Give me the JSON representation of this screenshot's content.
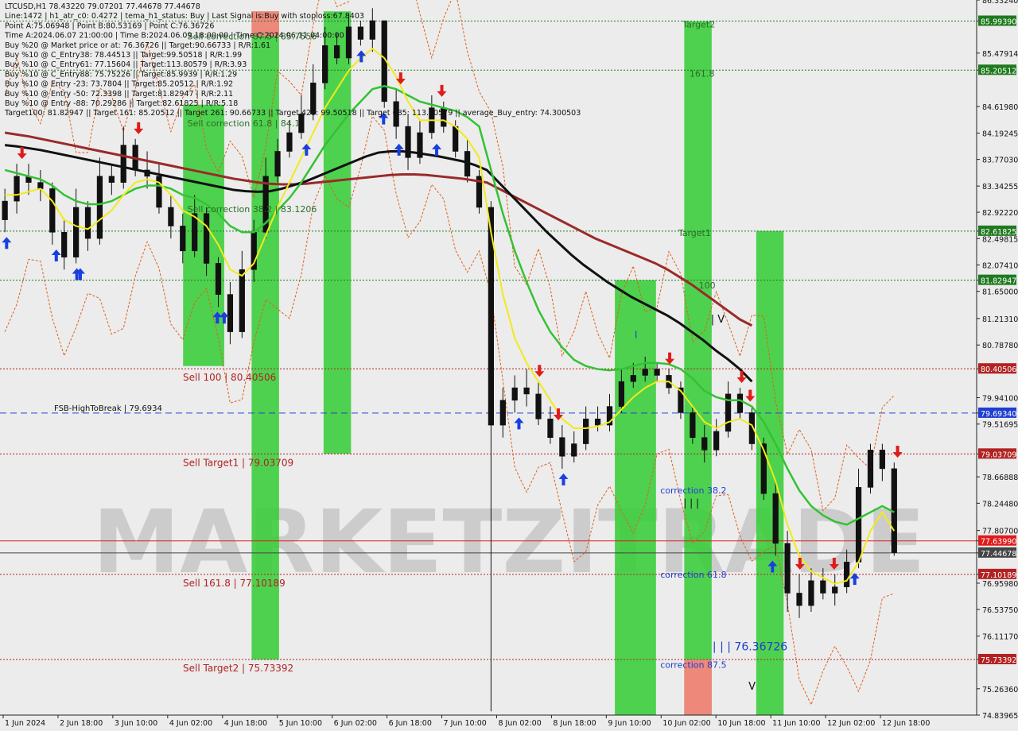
{
  "info_lines": [
    "LTCUSD,H1  78.43220 79.07201 77.44678 77.44678",
    "Line:1472 | h1_atr_c0: 0.4272 | tema_h1_status: Buy | Last Signal is:Buy with stoploss:67.8403",
    "Point A:75.06948 | Point B:80.53169 | Point C:76.36726",
    "Time A:2024.06.07 21:00:00 | Time B:2024.06.09 18:00:00 | Time C:2024.06.11 04:00:00",
    "Buy %20 @ Market price or at: 76.36726 || Target:90.66733 | R/R:1.61",
    "Buy %10 @ C_Entry38: 78.44513 || Target:99.50518 | R/R:1.99",
    "Buy %10 @ C_Entry61: 77.15604 || Target:113.80579 | R/R:3.93",
    "Buy %10 @ C_Entry88: 75.75226 || Target:85.9939 | R/R:1.29",
    "Buy %10 @ Entry -23: 73.7804 || Target:85.20512 | R/R:1.92",
    "Buy %10 @ Entry -50: 72.3398 || Target:81.82947 | R/R:2.11",
    "Buy %10 @ Entry -88: 70.29286 || Target:82.61825 | R/R:5.18",
    "Target100: 81.82947 || Target 161: 85.20512 || Target 261: 90.66733 || Target 423: 99.50518 || Target 685: 113.80579 || average_Buy_entry: 74.300503"
  ],
  "watermark": "MARKETZITRADE",
  "chart_data": {
    "type": "candlestick",
    "symbol": "LTCUSD",
    "timeframe": "H1",
    "ylim": [
      74.83965,
      86.3324
    ],
    "xlim": [
      0,
      1472
    ],
    "y_ticks": [
      "86.33240",
      "85.99390",
      "85.47914",
      "85.20512",
      "84.61980",
      "84.19245",
      "83.77030",
      "83.34255",
      "82.92220",
      "82.61825",
      "82.49815",
      "82.07410",
      "81.82947",
      "81.65000",
      "81.21310",
      "80.78780",
      "80.40506",
      "79.94100",
      "79.69340",
      "79.51695",
      "79.03709",
      "78.66888",
      "78.24480",
      "77.80700",
      "77.63990",
      "77.44678",
      "77.10189",
      "76.95980",
      "76.53750",
      "76.11170",
      "75.73392",
      "75.26360",
      "74.83965"
    ],
    "x_ticks": [
      {
        "label": "1 Jun 2024",
        "t": 0
      },
      {
        "label": "2 Jun 18:00",
        "t": 64
      },
      {
        "label": "3 Jun 10:00",
        "t": 128
      },
      {
        "label": "4 Jun 02:00",
        "t": 192
      },
      {
        "label": "4 Jun 18:00",
        "t": 256
      },
      {
        "label": "5 Jun 10:00",
        "t": 320
      },
      {
        "label": "6 Jun 02:00",
        "t": 384
      },
      {
        "label": "6 Jun 18:00",
        "t": 448
      },
      {
        "label": "7 Jun 10:00",
        "t": 512
      },
      {
        "label": "8 Jun 02:00",
        "t": 576
      },
      {
        "label": "8 Jun 18:00",
        "t": 640
      },
      {
        "label": "9 Jun 10:00",
        "t": 704
      },
      {
        "label": "10 Jun 02:00",
        "t": 768
      },
      {
        "label": "10 Jun 18:00",
        "t": 832
      },
      {
        "label": "11 Jun 10:00",
        "t": 896
      },
      {
        "label": "12 Jun 02:00",
        "t": 960
      },
      {
        "label": "12 Jun 18:00",
        "t": 1024
      }
    ],
    "h_levels": [
      {
        "label": "",
        "price": 85.9939,
        "color": "#1f7a1f",
        "axis_label": "85.99390"
      },
      {
        "label": "",
        "price": 85.20512,
        "color": "#1f7a1f",
        "axis_label": "85.20512"
      },
      {
        "label": "",
        "price": 82.61825,
        "color": "#1f7a1f",
        "axis_label": "82.61825"
      },
      {
        "label": "",
        "price": 81.82947,
        "color": "#1f7a1f",
        "axis_label": "81.82947"
      },
      {
        "label": "Sell 100 | 80.40506",
        "price": 80.40506,
        "color": "#b22222",
        "axis_label": "80.40506"
      },
      {
        "label": "FSB-HighToBreak | 79.6934",
        "price": 79.6934,
        "color": "#1f3fd0",
        "axis_label": "79.69340",
        "dash": "long"
      },
      {
        "label": "Sell Target1 | 79.03709",
        "price": 79.03709,
        "color": "#b22222",
        "axis_label": "79.03709"
      },
      {
        "label": "Sell 161.8 | 77.10189",
        "price": 77.10189,
        "color": "#b22222",
        "axis_label": "77.10189"
      },
      {
        "label": "Sell Target2 | 75.73392",
        "price": 75.73392,
        "color": "#b22222",
        "axis_label": "75.73392"
      }
    ],
    "solid_levels": [
      {
        "price": 77.6399,
        "color": "#e01b1b",
        "axis_label": "77.63990"
      },
      {
        "price": 77.44678,
        "color": "#444444",
        "axis_label": "77.44678"
      }
    ],
    "zones": [
      {
        "t0": 210,
        "t1": 258,
        "p0": 80.45,
        "p1": 84.65,
        "color": "#33cc33"
      },
      {
        "t0": 290,
        "t1": 322,
        "p0": 75.73,
        "p1": 86.15,
        "color": "#33cc33"
      },
      {
        "t0": 290,
        "t1": 322,
        "p0": 85.75,
        "p1": 86.15,
        "color": "#ff7f7f"
      },
      {
        "t0": 374,
        "t1": 406,
        "p0": 79.04,
        "p1": 86.15,
        "color": "#33cc33"
      },
      {
        "t0": 714,
        "t1": 762,
        "p0": 74.84,
        "p1": 81.83,
        "color": "#33cc33"
      },
      {
        "t0": 795,
        "t1": 827,
        "p0": 74.84,
        "p1": 85.99,
        "color": "#33cc33"
      },
      {
        "t0": 795,
        "t1": 827,
        "p0": 74.84,
        "p1": 75.73,
        "color": "#ff7f7f"
      },
      {
        "t0": 879,
        "t1": 911,
        "p0": 74.84,
        "p1": 82.62,
        "color": "#33cc33"
      }
    ],
    "texts": [
      {
        "text": "Target2",
        "t": 793,
        "p": 85.89,
        "color": "#2a6e2a",
        "size": 11
      },
      {
        "text": "161.8",
        "t": 801,
        "p": 85.1,
        "color": "#2a6e2a",
        "size": 11
      },
      {
        "text": "Target1",
        "t": 788,
        "p": 82.54,
        "color": "#2a6e2a",
        "size": 11
      },
      {
        "text": "100",
        "t": 812,
        "p": 81.7,
        "color": "#2a6e2a",
        "size": 11
      },
      {
        "text": "Sell correction 61.8 | 84.1",
        "t": 215,
        "p": 84.3,
        "color": "#2a6e2a",
        "size": 11
      },
      {
        "text": "Sell correction 38.2 | 83.1206",
        "t": 215,
        "p": 82.92,
        "color": "#2a6e2a",
        "size": 11
      },
      {
        "text": "Sell correction 87.5 | 85.7556",
        "t": 215,
        "p": 85.7,
        "color": "#2a6e2a",
        "size": 11
      },
      {
        "text": "correction 38.2",
        "t": 767,
        "p": 78.4,
        "color": "#1f3fd0",
        "size": 11
      },
      {
        "text": "correction 61.8",
        "t": 767,
        "p": 77.05,
        "color": "#1f3fd0",
        "size": 11
      },
      {
        "text": "correction 87.5",
        "t": 767,
        "p": 75.6,
        "color": "#1f3fd0",
        "size": 11
      },
      {
        "text": "| | | 76.36726",
        "t": 828,
        "p": 75.88,
        "color": "#1f3fd0",
        "size": 14
      },
      {
        "text": "| V",
        "t": 826,
        "p": 81.15,
        "color": "#111111",
        "size": 13
      },
      {
        "text": "I",
        "t": 737,
        "p": 80.9,
        "color": "#1f3fd0",
        "size": 12
      },
      {
        "text": "| | |",
        "t": 794,
        "p": 78.2,
        "color": "#111111",
        "size": 12
      },
      {
        "text": "V",
        "t": 870,
        "p": 75.25,
        "color": "#111111",
        "size": 13
      }
    ],
    "up_arrows_t": [
      4,
      62,
      86,
      90,
      250,
      258,
      354,
      418,
      444,
      462,
      506,
      602,
      654,
      898,
      994
    ],
    "down_arrows_t": [
      22,
      158,
      464,
      512,
      626,
      648,
      778,
      862,
      872,
      930,
      970,
      1044
    ],
    "series_close": [
      83.1,
      83.5,
      83.4,
      83.3,
      82.6,
      82.2,
      83.0,
      82.5,
      83.5,
      83.4,
      84.0,
      83.6,
      83.5,
      83.0,
      82.7,
      82.3,
      82.9,
      82.1,
      81.6,
      81.0,
      82.0,
      82.6,
      83.5,
      83.9,
      84.2,
      84.5,
      85.0,
      85.6,
      85.4,
      85.9,
      85.7,
      86.0,
      84.7,
      84.3,
      83.8,
      84.2,
      84.6,
      84.3,
      83.9,
      83.5,
      83.0,
      79.5,
      79.9,
      80.1,
      80.0,
      79.6,
      79.3,
      79.0,
      79.2,
      79.6,
      79.5,
      79.8,
      80.2,
      80.3,
      80.4,
      80.3,
      80.1,
      79.7,
      79.3,
      79.1,
      79.4,
      80.0,
      79.7,
      79.2,
      78.4,
      77.6,
      76.8,
      76.6,
      77.0,
      76.8,
      76.9,
      77.3,
      78.5,
      79.1,
      78.8,
      77.45
    ],
    "series_open": [
      82.8,
      83.1,
      83.5,
      83.4,
      83.3,
      82.6,
      82.2,
      83.0,
      82.5,
      83.5,
      83.4,
      84.0,
      83.6,
      83.5,
      83.0,
      82.7,
      82.3,
      82.9,
      82.1,
      81.6,
      81.0,
      82.0,
      82.6,
      83.5,
      83.9,
      84.2,
      84.5,
      85.0,
      85.6,
      85.4,
      85.9,
      85.7,
      86.0,
      84.7,
      84.3,
      83.8,
      84.2,
      84.6,
      84.3,
      83.9,
      83.5,
      83.0,
      79.5,
      79.9,
      80.1,
      80.0,
      79.6,
      79.3,
      79.0,
      79.2,
      79.6,
      79.5,
      79.8,
      80.2,
      80.3,
      80.4,
      80.3,
      80.1,
      79.7,
      79.3,
      79.1,
      79.4,
      80.0,
      79.7,
      79.2,
      78.4,
      77.6,
      76.8,
      76.6,
      77.0,
      76.8,
      76.9,
      77.3,
      78.5,
      79.1,
      78.8
    ],
    "series_high": [
      83.3,
      83.7,
      83.7,
      83.6,
      83.4,
      82.8,
      83.3,
      83.1,
      83.8,
      83.7,
      84.3,
      84.1,
      83.9,
      83.7,
      83.2,
      82.9,
      83.2,
      83.0,
      82.2,
      81.8,
      82.3,
      82.8,
      83.8,
      84.1,
      84.4,
      84.8,
      85.3,
      85.9,
      85.8,
      86.1,
      86.0,
      86.2,
      86.0,
      84.9,
      84.5,
      84.4,
      84.8,
      84.7,
      84.4,
      84.1,
      83.6,
      83.1,
      80.1,
      80.3,
      80.4,
      80.2,
      79.8,
      79.5,
      79.4,
      79.8,
      79.8,
      80.0,
      80.4,
      80.5,
      80.6,
      80.5,
      80.4,
      80.2,
      79.8,
      79.5,
      79.6,
      80.2,
      80.1,
      79.8,
      79.3,
      78.6,
      77.8,
      77.1,
      77.2,
      77.2,
      77.1,
      77.5,
      78.8,
      79.2,
      79.2,
      78.9
    ],
    "series_low": [
      82.6,
      82.9,
      83.2,
      83.1,
      82.4,
      82.0,
      82.1,
      82.3,
      82.4,
      83.2,
      83.3,
      83.5,
      83.3,
      82.9,
      82.5,
      82.1,
      82.2,
      81.9,
      81.4,
      80.8,
      80.9,
      81.8,
      82.5,
      83.4,
      83.8,
      84.1,
      84.4,
      84.9,
      85.3,
      85.3,
      85.6,
      85.5,
      84.6,
      84.1,
      83.6,
      83.7,
      84.1,
      84.2,
      83.8,
      83.4,
      82.9,
      74.9,
      79.3,
      79.7,
      79.8,
      79.5,
      79.2,
      78.8,
      78.9,
      79.1,
      79.4,
      79.4,
      79.7,
      80.1,
      80.2,
      80.2,
      80.0,
      79.6,
      79.2,
      78.9,
      79.0,
      79.3,
      79.6,
      79.1,
      78.3,
      77.4,
      76.5,
      76.4,
      76.5,
      76.7,
      76.6,
      76.8,
      77.2,
      78.4,
      78.6,
      77.4
    ],
    "series_ma_yellow": [
      83.2,
      83.2,
      83.25,
      83.3,
      83.1,
      82.8,
      82.7,
      82.65,
      82.8,
      82.95,
      83.2,
      83.4,
      83.45,
      83.4,
      83.2,
      82.95,
      82.85,
      82.7,
      82.4,
      82.0,
      81.9,
      82.1,
      82.55,
      83.0,
      83.4,
      83.8,
      84.2,
      84.6,
      84.9,
      85.2,
      85.4,
      85.55,
      85.4,
      85.1,
      84.7,
      84.4,
      84.4,
      84.4,
      84.3,
      84.1,
      83.8,
      82.6,
      81.6,
      80.9,
      80.5,
      80.2,
      79.9,
      79.6,
      79.45,
      79.45,
      79.48,
      79.55,
      79.75,
      79.95,
      80.1,
      80.2,
      80.2,
      80.05,
      79.8,
      79.55,
      79.45,
      79.55,
      79.6,
      79.5,
      79.1,
      78.6,
      77.9,
      77.4,
      77.15,
      77.05,
      76.95,
      77.0,
      77.3,
      77.8,
      78.1,
      77.8
    ],
    "series_ma_green": [
      83.6,
      83.55,
      83.5,
      83.45,
      83.35,
      83.2,
      83.1,
      83.05,
      83.05,
      83.1,
      83.2,
      83.3,
      83.35,
      83.35,
      83.3,
      83.2,
      83.15,
      83.05,
      82.9,
      82.7,
      82.6,
      82.6,
      82.75,
      82.95,
      83.15,
      83.4,
      83.7,
      84.0,
      84.25,
      84.5,
      84.7,
      84.9,
      84.95,
      84.9,
      84.8,
      84.7,
      84.65,
      84.6,
      84.55,
      84.45,
      84.3,
      83.6,
      82.9,
      82.3,
      81.8,
      81.35,
      81.0,
      80.75,
      80.55,
      80.45,
      80.4,
      80.38,
      80.4,
      80.45,
      80.5,
      80.5,
      80.48,
      80.4,
      80.25,
      80.05,
      79.95,
      79.9,
      79.9,
      79.8,
      79.55,
      79.2,
      78.8,
      78.45,
      78.2,
      78.05,
      77.95,
      77.9,
      78.0,
      78.1,
      78.2,
      78.1
    ],
    "series_ma_black": [
      84.0,
      83.98,
      83.95,
      83.92,
      83.88,
      83.84,
      83.8,
      83.76,
      83.72,
      83.68,
      83.64,
      83.6,
      83.56,
      83.52,
      83.48,
      83.44,
      83.4,
      83.36,
      83.32,
      83.28,
      83.26,
      83.25,
      83.26,
      83.3,
      83.36,
      83.42,
      83.5,
      83.58,
      83.66,
      83.74,
      83.82,
      83.88,
      83.9,
      83.9,
      83.88,
      83.85,
      83.82,
      83.78,
      83.74,
      83.68,
      83.6,
      83.4,
      83.2,
      83.0,
      82.8,
      82.6,
      82.42,
      82.24,
      82.08,
      81.94,
      81.8,
      81.68,
      81.56,
      81.46,
      81.36,
      81.26,
      81.14,
      81.0,
      80.86,
      80.7,
      80.56,
      80.4,
      80.2
    ],
    "series_ma_darkred": [
      84.2,
      84.17,
      84.14,
      84.1,
      84.06,
      84.02,
      83.98,
      83.94,
      83.9,
      83.86,
      83.82,
      83.78,
      83.74,
      83.7,
      83.66,
      83.62,
      83.58,
      83.54,
      83.5,
      83.46,
      83.43,
      83.4,
      83.38,
      83.37,
      83.37,
      83.38,
      83.4,
      83.42,
      83.44,
      83.46,
      83.48,
      83.5,
      83.52,
      83.53,
      83.53,
      83.52,
      83.5,
      83.48,
      83.46,
      83.43,
      83.4,
      83.3,
      83.2,
      83.1,
      83.0,
      82.9,
      82.8,
      82.7,
      82.6,
      82.5,
      82.42,
      82.34,
      82.26,
      82.18,
      82.1,
      82.0,
      81.88,
      81.76,
      81.62,
      81.48,
      81.34,
      81.2,
      81.1
    ]
  }
}
